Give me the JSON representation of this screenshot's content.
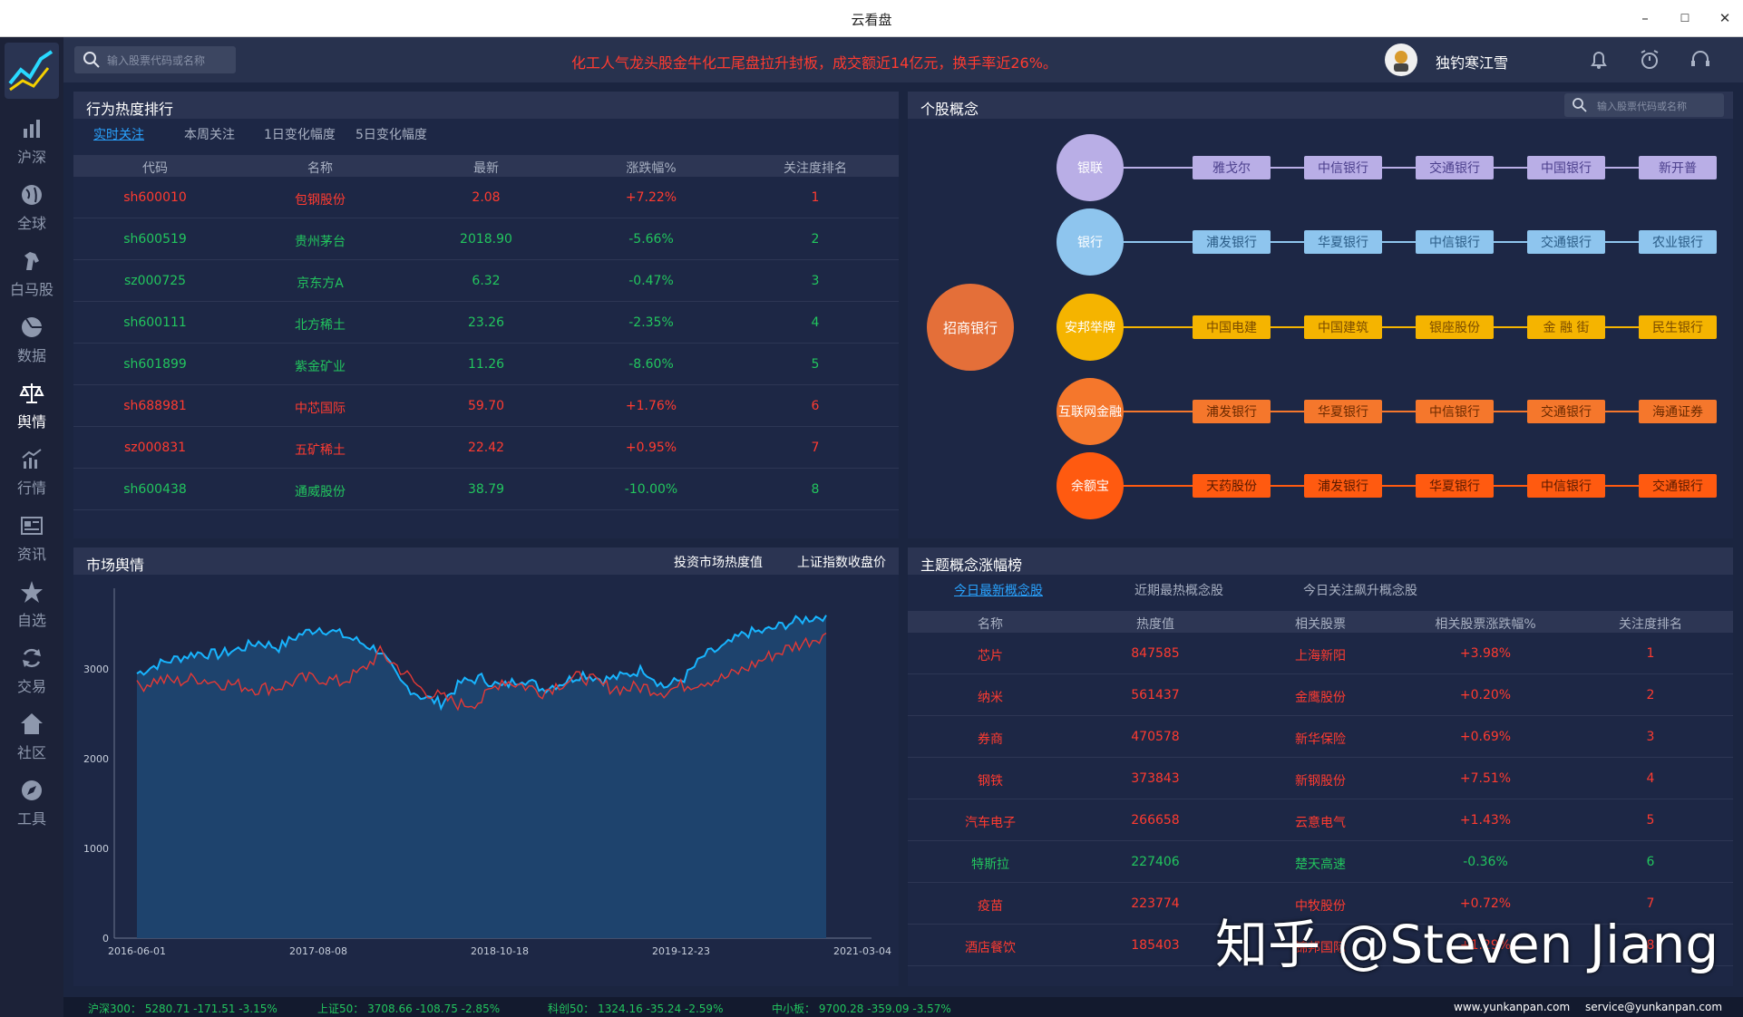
{
  "window": {
    "title": "云看盘",
    "min": "–",
    "max": "☐",
    "close": "✕"
  },
  "colors": {
    "accent": "#29a3ff",
    "up": "#ff3b30",
    "down": "#22c55e",
    "bg": "#1b2540"
  },
  "sidebar": {
    "items": [
      {
        "label": "沪深",
        "icon": "bar-chart-icon"
      },
      {
        "label": "全球",
        "icon": "globe-icon"
      },
      {
        "label": "白马股",
        "icon": "horse-icon"
      },
      {
        "label": "数据",
        "icon": "pie-icon"
      },
      {
        "label": "舆情",
        "icon": "scale-icon"
      },
      {
        "label": "行情",
        "icon": "trend-icon"
      },
      {
        "label": "资讯",
        "icon": "news-icon"
      },
      {
        "label": "自选",
        "icon": "star-icon"
      },
      {
        "label": "交易",
        "icon": "refresh-icon"
      },
      {
        "label": "社区",
        "icon": "home-icon"
      },
      {
        "label": "工具",
        "icon": "compass-icon"
      }
    ]
  },
  "topbar": {
    "search_placeholder": "输入股票代码或名称",
    "ticker": "化工人气龙头股金牛化工尾盘拉升封板，成交额近14亿元，换手率近26%。",
    "username": "独钓寒江雪"
  },
  "heat": {
    "title": "行为热度排行",
    "tabs": [
      "实时关注",
      "本周关注",
      "1日变化幅度",
      "5日变化幅度"
    ],
    "columns": [
      "代码",
      "名称",
      "最新",
      "涨跌幅%",
      "关注度排名"
    ],
    "rows": [
      {
        "code": "sh600010",
        "name": "包钢股份",
        "price": "2.08",
        "chg": "+7.22%",
        "rank": "1",
        "up": true
      },
      {
        "code": "sh600519",
        "name": "贵州茅台",
        "price": "2018.90",
        "chg": "-5.66%",
        "rank": "2",
        "up": false
      },
      {
        "code": "sz000725",
        "name": "京东方A",
        "price": "6.32",
        "chg": "-0.47%",
        "rank": "3",
        "up": false
      },
      {
        "code": "sh600111",
        "name": "北方稀土",
        "price": "23.26",
        "chg": "-2.35%",
        "rank": "4",
        "up": false
      },
      {
        "code": "sh601899",
        "name": "紫金矿业",
        "price": "11.26",
        "chg": "-8.60%",
        "rank": "5",
        "up": false
      },
      {
        "code": "sh688981",
        "name": "中芯国际",
        "price": "59.70",
        "chg": "+1.76%",
        "rank": "6",
        "up": true
      },
      {
        "code": "sz000831",
        "name": "五矿稀土",
        "price": "22.42",
        "chg": "+0.95%",
        "rank": "7",
        "up": true
      },
      {
        "code": "sh600438",
        "name": "通威股份",
        "price": "38.79",
        "chg": "-10.00%",
        "rank": "8",
        "up": false
      }
    ]
  },
  "concept": {
    "title": "个股概念",
    "search_placeholder": "输入股票代码或名称",
    "center": "招商银行",
    "branches": [
      {
        "name": "银联",
        "color": "#b9aee6",
        "chipbg": "#b9aee6",
        "chiptext": "#4b3f8c",
        "items": [
          "雅戈尔",
          "中信银行",
          "交通银行",
          "中国银行",
          "新开普"
        ]
      },
      {
        "name": "银行",
        "color": "#8ec5ee",
        "chipbg": "#8ec5ee",
        "chiptext": "#2b5c86",
        "items": [
          "浦发银行",
          "华夏银行",
          "中信银行",
          "交通银行",
          "农业银行"
        ]
      },
      {
        "name": "安邦举牌",
        "color": "#f5b400",
        "chipbg": "#f5b400",
        "chiptext": "#7a4b00",
        "items": [
          "中国电建",
          "中国建筑",
          "银座股份",
          "金 融 街",
          "民生银行"
        ]
      },
      {
        "name": "互联网金融",
        "color": "#f5772c",
        "chipbg": "#f5772c",
        "chiptext": "#6b2a00",
        "items": [
          "浦发银行",
          "华夏银行",
          "中信银行",
          "交通银行",
          "海通证券"
        ]
      },
      {
        "name": "余额宝",
        "color": "#ff5a10",
        "chipbg": "#ff5a10",
        "chiptext": "#5a1a00",
        "items": [
          "天药股份",
          "浦发银行",
          "华夏银行",
          "中信银行",
          "交通银行"
        ]
      }
    ]
  },
  "market": {
    "title": "市场舆情",
    "legend": [
      "投资市场热度值",
      "上证指数收盘价"
    ],
    "chart_data": {
      "type": "area",
      "x_ticks": [
        "2016-06-01",
        "2017-08-08",
        "2018-10-18",
        "2019-12-23",
        "2021-03-04"
      ],
      "y_ticks": [
        0,
        1000,
        2000,
        3000
      ],
      "ylim": [
        0,
        3900
      ],
      "series": [
        {
          "name": "投资市场热度值",
          "color": "#18b5ff",
          "values": [
            2950,
            3050,
            3120,
            3180,
            3160,
            3220,
            3300,
            3240,
            3380,
            3460,
            3390,
            3300,
            3200,
            2850,
            2700,
            2620,
            2850,
            2900,
            2800,
            2900,
            2780,
            2850,
            2950,
            2880,
            2920,
            3000,
            2800,
            2900,
            3150,
            3250,
            3400,
            3420,
            3500,
            3560,
            3600
          ]
        },
        {
          "name": "上证指数收盘价",
          "color": "#e53935",
          "values": [
            2800,
            2880,
            2860,
            2900,
            2850,
            2820,
            2780,
            2800,
            2880,
            2900,
            2850,
            2960,
            3180,
            3000,
            2780,
            2680,
            2600,
            2650,
            2880,
            2820,
            2750,
            2850,
            2920,
            2810,
            2780,
            2800,
            2750,
            2820,
            2870,
            2900,
            3000,
            3120,
            3220,
            3300,
            3400
          ]
        }
      ]
    }
  },
  "theme": {
    "title": "主题概念涨幅榜",
    "tabs": [
      "今日最新概念股",
      "近期最热概念股",
      "今日关注飙升概念股"
    ],
    "columns": [
      "名称",
      "热度值",
      "相关股票",
      "相关股票涨跌幅%",
      "关注度排名"
    ],
    "rows": [
      {
        "name": "芯片",
        "heat": "847585",
        "stock": "上海新阳",
        "chg": "+3.98%",
        "rank": "1",
        "up": true
      },
      {
        "name": "纳米",
        "heat": "561437",
        "stock": "金鹰股份",
        "chg": "+0.20%",
        "rank": "2",
        "up": true
      },
      {
        "name": "券商",
        "heat": "470578",
        "stock": "新华保险",
        "chg": "+0.69%",
        "rank": "3",
        "up": true
      },
      {
        "name": "钢铁",
        "heat": "373843",
        "stock": "新钢股份",
        "chg": "+7.51%",
        "rank": "4",
        "up": true
      },
      {
        "name": "汽车电子",
        "heat": "266658",
        "stock": "云意电气",
        "chg": "+1.43%",
        "rank": "5",
        "up": true
      },
      {
        "name": "特斯拉",
        "heat": "227406",
        "stock": "楚天高速",
        "chg": "-0.36%",
        "rank": "6",
        "up": false
      },
      {
        "name": "疫苗",
        "heat": "223774",
        "stock": "中牧股份",
        "chg": "+0.72%",
        "rank": "7",
        "up": true
      },
      {
        "name": "酒店餐饮",
        "heat": "185403",
        "stock": "锦邦国际",
        "chg": "+1.29%",
        "rank": "8",
        "up": true
      }
    ]
  },
  "footer": {
    "items": [
      "沪深300： 5280.71  -171.51  -3.15%",
      "上证50： 3708.66  -108.75  -2.85%",
      "科创50： 1324.16  -35.24  -2.59%",
      "中小板： 9700.28  -359.09  -3.57%"
    ],
    "site": "www.yunkanpan.com",
    "email": "service@yunkanpan.com"
  },
  "watermark": "知乎 @Steven Jiang"
}
